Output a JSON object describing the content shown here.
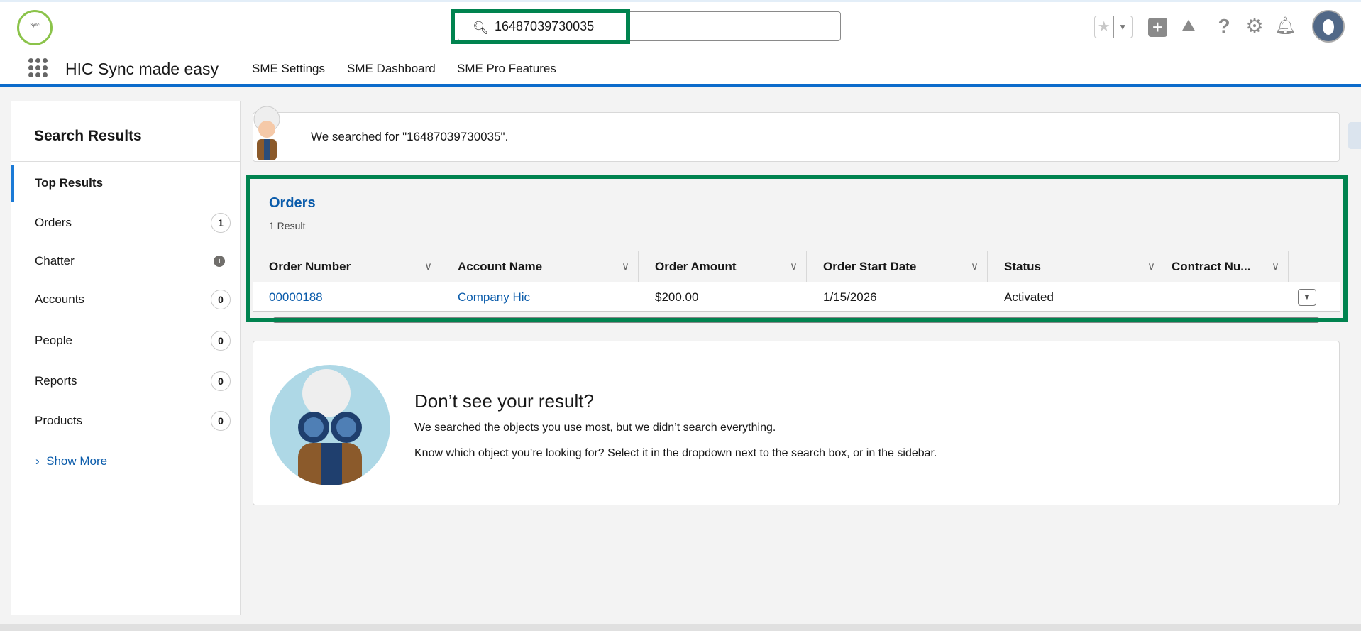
{
  "header": {
    "search_value": "16487039730035",
    "app_name": "HIC Sync made easy",
    "logo_text": "Sync made easy",
    "nav": [
      "SME Settings",
      "SME Dashboard",
      "SME Pro Features"
    ]
  },
  "sidebar": {
    "title": "Search Results",
    "items": [
      {
        "label": "Top Results"
      },
      {
        "label": "Orders",
        "count": "1"
      },
      {
        "label": "Chatter",
        "count": "i"
      },
      {
        "label": "Accounts",
        "count": "0"
      },
      {
        "label": "People",
        "count": "0"
      },
      {
        "label": "Reports",
        "count": "0"
      },
      {
        "label": "Products",
        "count": "0"
      }
    ],
    "show_more": "Show More"
  },
  "notice": "We searched for \"16487039730035\".",
  "orders": {
    "title": "Orders",
    "count": "1 Result",
    "columns": [
      "Order Number",
      "Account Name",
      "Order Amount",
      "Order Start Date",
      "Status",
      "Contract Nu..."
    ],
    "rows": [
      {
        "order_number": "00000188",
        "account": "Company Hic",
        "amount": "$200.00",
        "start_date": "1/15/2026",
        "status": "Activated",
        "contract": ""
      }
    ]
  },
  "no_result": {
    "title": "Don’t see your result?",
    "line1": "We searched the objects you use most, but we didn’t search everything.",
    "line2": "Know which object you’re looking for? Select it in the dropdown next to the search box, or in the sidebar."
  },
  "colors": {
    "highlight": "#00834f",
    "brand": "#0b6bcb",
    "link": "#0b5cab"
  }
}
